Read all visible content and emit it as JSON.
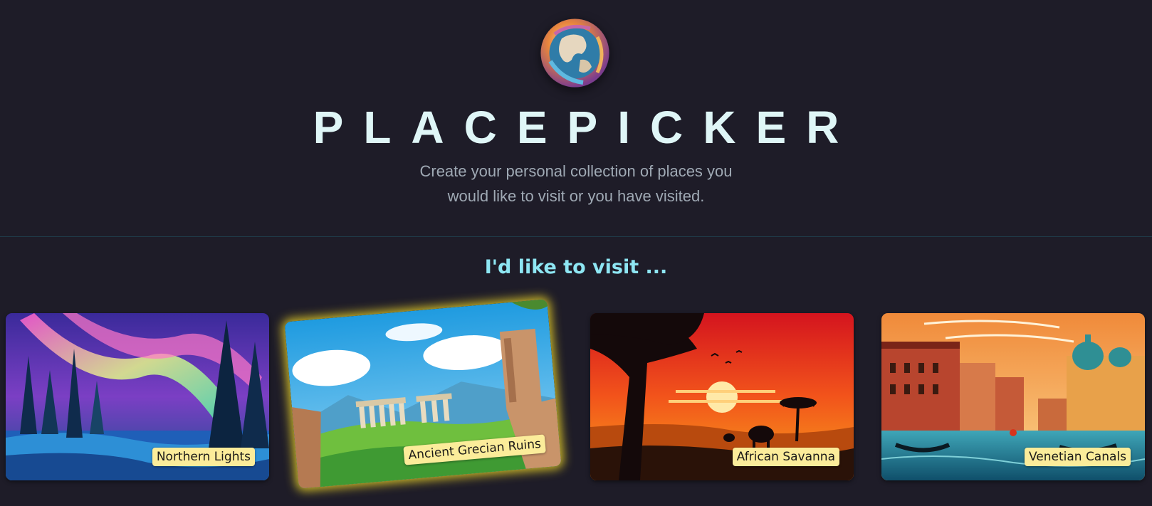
{
  "header": {
    "logo_icon": "globe-logo-icon",
    "title": "PLACEPICKER",
    "tagline_line1": "Create your personal collection of places you",
    "tagline_line2": "would like to visit or you have visited."
  },
  "section": {
    "title": "I'd like to visit ..."
  },
  "places": [
    {
      "label": "Northern Lights",
      "selected": false
    },
    {
      "label": "Ancient Grecian Ruins",
      "selected": true
    },
    {
      "label": "African Savanna",
      "selected": false
    },
    {
      "label": "Venetian Canals",
      "selected": false
    }
  ],
  "colors": {
    "background": "#1e1c28",
    "title": "#dff6f7",
    "tagline": "#9fa9b4",
    "section_title": "#8ee6f3",
    "label_bg": "#fbec9a",
    "selected_glow": "#ebd428"
  }
}
